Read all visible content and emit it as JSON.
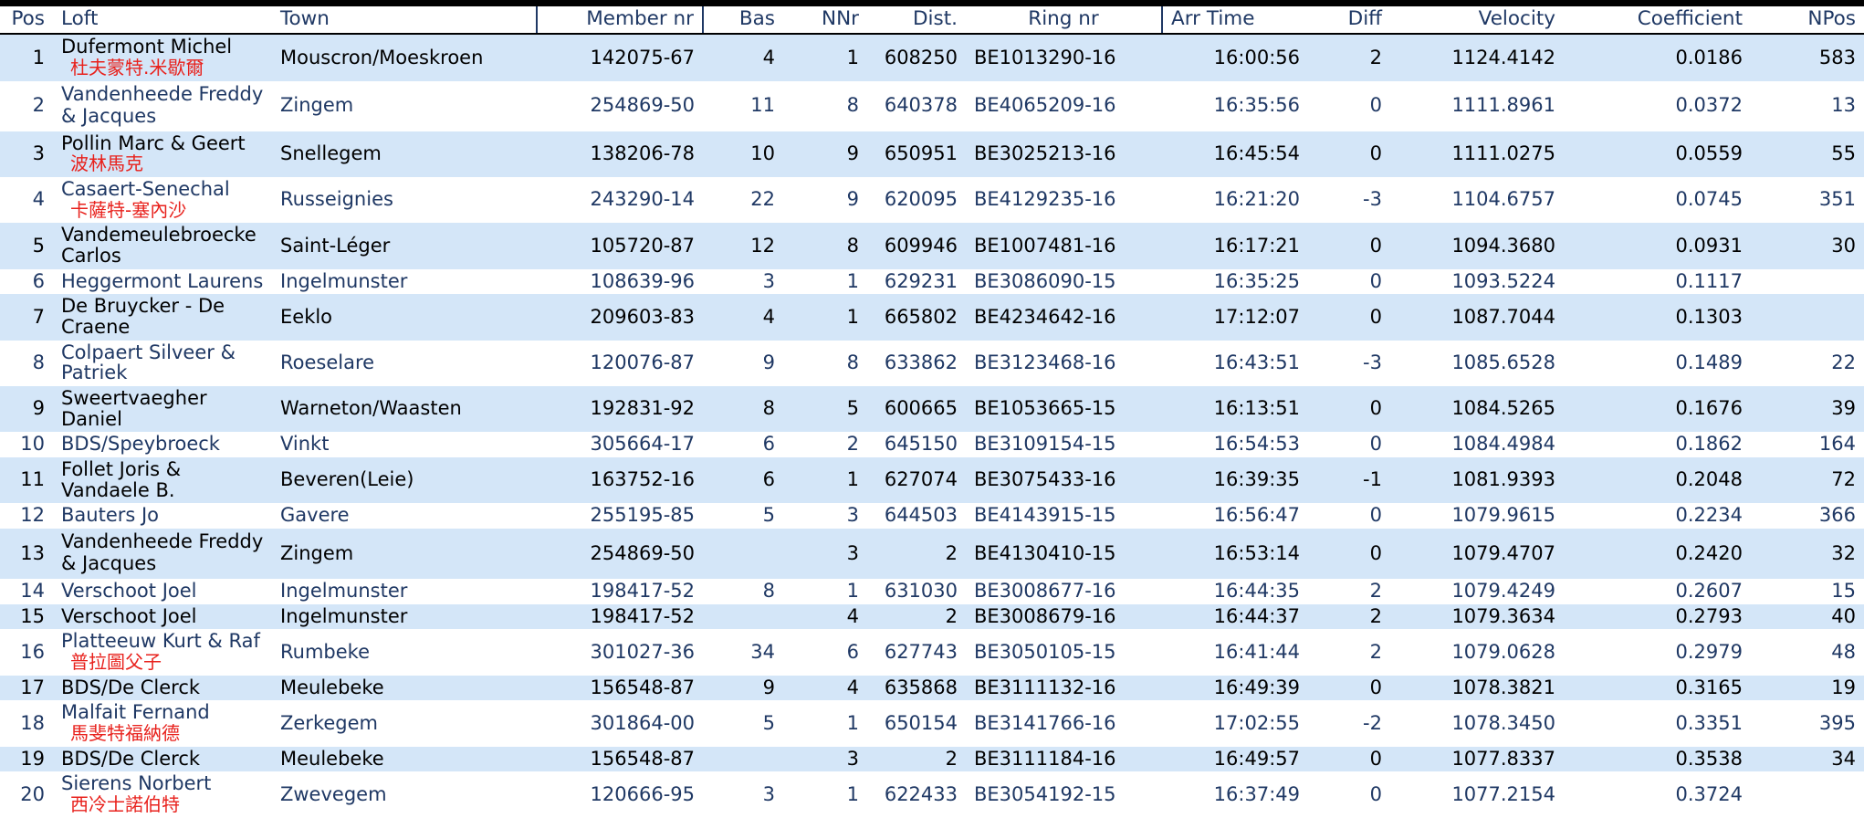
{
  "table": {
    "columns": [
      {
        "key": "pos",
        "label": "Pos",
        "align": "right"
      },
      {
        "key": "loft",
        "label": "Loft",
        "align": "left"
      },
      {
        "key": "town",
        "label": "Town",
        "align": "left"
      },
      {
        "key": "member_nr",
        "label": "Member nr",
        "align": "right"
      },
      {
        "key": "bas",
        "label": "Bas",
        "align": "right"
      },
      {
        "key": "nnr",
        "label": "NNr",
        "align": "right"
      },
      {
        "key": "dist",
        "label": "Dist.",
        "align": "right"
      },
      {
        "key": "ring_nr",
        "label": "Ring nr",
        "align": "left"
      },
      {
        "key": "arr_time",
        "label": "Arr Time",
        "align": "right"
      },
      {
        "key": "diff",
        "label": "Diff",
        "align": "right"
      },
      {
        "key": "velocity",
        "label": "Velocity",
        "align": "right"
      },
      {
        "key": "coefficient",
        "label": "Coefficient",
        "align": "right"
      },
      {
        "key": "npos",
        "label": "NPos",
        "align": "right"
      }
    ],
    "colors": {
      "header_text": "#1f3864",
      "odd_row_bg": "#d4e6f8",
      "even_row_bg": "#ffffff",
      "odd_row_text": "#000000",
      "even_row_text": "#1f3864",
      "chinese_name": "#e8211c",
      "rule": "#000000"
    },
    "rows": [
      {
        "pos": "1",
        "loft": "Dufermont Michel",
        "loft_cn": "杜夫蒙特.米歇爾",
        "town": "Mouscron/Moeskroen",
        "member_nr": "142075-67",
        "bas": "4",
        "nnr": "1",
        "dist": "608250",
        "ring_nr": "BE1013290-16",
        "arr_time": "16:00:56",
        "diff": "2",
        "velocity": "1124.4142",
        "coefficient": "0.0186",
        "npos": "583"
      },
      {
        "pos": "2",
        "loft": "Vandenheede Freddy & Jacques",
        "loft_cn": "",
        "town": "Zingem",
        "member_nr": "254869-50",
        "bas": "11",
        "nnr": "8",
        "dist": "640378",
        "ring_nr": "BE4065209-16",
        "arr_time": "16:35:56",
        "diff": "0",
        "velocity": "1111.8961",
        "coefficient": "0.0372",
        "npos": "13"
      },
      {
        "pos": "3",
        "loft": "Pollin Marc & Geert",
        "loft_cn": "波林馬克",
        "town": "Snellegem",
        "member_nr": "138206-78",
        "bas": "10",
        "nnr": "9",
        "dist": "650951",
        "ring_nr": "BE3025213-16",
        "arr_time": "16:45:54",
        "diff": "0",
        "velocity": "1111.0275",
        "coefficient": "0.0559",
        "npos": "55"
      },
      {
        "pos": "4",
        "loft": "Casaert-Senechal",
        "loft_cn": "卡薩特-塞內沙",
        "town": "Russeignies",
        "member_nr": "243290-14",
        "bas": "22",
        "nnr": "9",
        "dist": "620095",
        "ring_nr": "BE4129235-16",
        "arr_time": "16:21:20",
        "diff": "-3",
        "velocity": "1104.6757",
        "coefficient": "0.0745",
        "npos": "351"
      },
      {
        "pos": "5",
        "loft": "Vandemeulebroecke Carlos",
        "loft_cn": "",
        "town": "Saint-Léger",
        "member_nr": "105720-87",
        "bas": "12",
        "nnr": "8",
        "dist": "609946",
        "ring_nr": "BE1007481-16",
        "arr_time": "16:17:21",
        "diff": "0",
        "velocity": "1094.3680",
        "coefficient": "0.0931",
        "npos": "30"
      },
      {
        "pos": "6",
        "loft": "Heggermont Laurens",
        "loft_cn": "",
        "town": "Ingelmunster",
        "member_nr": "108639-96",
        "bas": "3",
        "nnr": "1",
        "dist": "629231",
        "ring_nr": "BE3086090-15",
        "arr_time": "16:35:25",
        "diff": "0",
        "velocity": "1093.5224",
        "coefficient": "0.1117",
        "npos": ""
      },
      {
        "pos": "7",
        "loft": "De Bruycker - De Craene",
        "loft_cn": "",
        "town": "Eeklo",
        "member_nr": "209603-83",
        "bas": "4",
        "nnr": "1",
        "dist": "665802",
        "ring_nr": "BE4234642-16",
        "arr_time": "17:12:07",
        "diff": "0",
        "velocity": "1087.7044",
        "coefficient": "0.1303",
        "npos": ""
      },
      {
        "pos": "8",
        "loft": "Colpaert Silveer & Patriek",
        "loft_cn": "",
        "town": "Roeselare",
        "member_nr": "120076-87",
        "bas": "9",
        "nnr": "8",
        "dist": "633862",
        "ring_nr": "BE3123468-16",
        "arr_time": "16:43:51",
        "diff": "-3",
        "velocity": "1085.6528",
        "coefficient": "0.1489",
        "npos": "22"
      },
      {
        "pos": "9",
        "loft": "Sweertvaegher Daniel",
        "loft_cn": "",
        "town": "Warneton/Waasten",
        "member_nr": "192831-92",
        "bas": "8",
        "nnr": "5",
        "dist": "600665",
        "ring_nr": "BE1053665-15",
        "arr_time": "16:13:51",
        "diff": "0",
        "velocity": "1084.5265",
        "coefficient": "0.1676",
        "npos": "39"
      },
      {
        "pos": "10",
        "loft": "BDS/Speybroeck",
        "loft_cn": "",
        "town": "Vinkt",
        "member_nr": "305664-17",
        "bas": "6",
        "nnr": "2",
        "dist": "645150",
        "ring_nr": "BE3109154-15",
        "arr_time": "16:54:53",
        "diff": "0",
        "velocity": "1084.4984",
        "coefficient": "0.1862",
        "npos": "164"
      },
      {
        "pos": "11",
        "loft": "Follet Joris & Vandaele B.",
        "loft_cn": "",
        "town": "Beveren(Leie)",
        "member_nr": "163752-16",
        "bas": "6",
        "nnr": "1",
        "dist": "627074",
        "ring_nr": "BE3075433-16",
        "arr_time": "16:39:35",
        "diff": "-1",
        "velocity": "1081.9393",
        "coefficient": "0.2048",
        "npos": "72"
      },
      {
        "pos": "12",
        "loft": "Bauters Jo",
        "loft_cn": "",
        "town": "Gavere",
        "member_nr": "255195-85",
        "bas": "5",
        "nnr": "3",
        "dist": "644503",
        "ring_nr": "BE4143915-15",
        "arr_time": "16:56:47",
        "diff": "0",
        "velocity": "1079.9615",
        "coefficient": "0.2234",
        "npos": "366"
      },
      {
        "pos": "13",
        "loft": "Vandenheede Freddy & Jacques",
        "loft_cn": "",
        "town": "Zingem",
        "member_nr": "254869-50",
        "bas": "",
        "nnr": "3",
        "dist": "2",
        "ring_nr": "BE4130410-15",
        "arr_time": "16:53:14",
        "diff": "0",
        "velocity": "1079.4707",
        "coefficient": "0.2420",
        "npos": "32"
      },
      {
        "pos": "14",
        "loft": "Verschoot Joel",
        "loft_cn": "",
        "town": "Ingelmunster",
        "member_nr": "198417-52",
        "bas": "8",
        "nnr": "1",
        "dist": "631030",
        "ring_nr": "BE3008677-16",
        "arr_time": "16:44:35",
        "diff": "2",
        "velocity": "1079.4249",
        "coefficient": "0.2607",
        "npos": "15"
      },
      {
        "pos": "15",
        "loft": "Verschoot Joel",
        "loft_cn": "",
        "town": "Ingelmunster",
        "member_nr": "198417-52",
        "bas": "",
        "nnr": "4",
        "dist": "2",
        "ring_nr": "BE3008679-16",
        "arr_time": "16:44:37",
        "diff": "2",
        "velocity": "1079.3634",
        "coefficient": "0.2793",
        "npos": "40"
      },
      {
        "pos": "16",
        "loft": "Platteeuw Kurt & Raf",
        "loft_cn": "普拉圖父子",
        "town": "Rumbeke",
        "member_nr": "301027-36",
        "bas": "34",
        "nnr": "6",
        "dist": "627743",
        "ring_nr": "BE3050105-15",
        "arr_time": "16:41:44",
        "diff": "2",
        "velocity": "1079.0628",
        "coefficient": "0.2979",
        "npos": "48"
      },
      {
        "pos": "17",
        "loft": "BDS/De Clerck",
        "loft_cn": "",
        "town": "Meulebeke",
        "member_nr": "156548-87",
        "bas": "9",
        "nnr": "4",
        "dist": "635868",
        "ring_nr": "BE3111132-16",
        "arr_time": "16:49:39",
        "diff": "0",
        "velocity": "1078.3821",
        "coefficient": "0.3165",
        "npos": "19"
      },
      {
        "pos": "18",
        "loft": "Malfait Fernand",
        "loft_cn": "馬斐特福納德",
        "town": "Zerkegem",
        "member_nr": "301864-00",
        "bas": "5",
        "nnr": "1",
        "dist": "650154",
        "ring_nr": "BE3141766-16",
        "arr_time": "17:02:55",
        "diff": "-2",
        "velocity": "1078.3450",
        "coefficient": "0.3351",
        "npos": "395"
      },
      {
        "pos": "19",
        "loft": "BDS/De Clerck",
        "loft_cn": "",
        "town": "Meulebeke",
        "member_nr": "156548-87",
        "bas": "",
        "nnr": "3",
        "dist": "2",
        "ring_nr": "BE3111184-16",
        "arr_time": "16:49:57",
        "diff": "0",
        "velocity": "1077.8337",
        "coefficient": "0.3538",
        "npos": "34"
      },
      {
        "pos": "20",
        "loft": "Sierens Norbert",
        "loft_cn": "西冷士諾伯特",
        "town": "Zwevegem",
        "member_nr": "120666-95",
        "bas": "3",
        "nnr": "1",
        "dist": "622433",
        "ring_nr": "BE3054192-15",
        "arr_time": "16:37:49",
        "diff": "0",
        "velocity": "1077.2154",
        "coefficient": "0.3724",
        "npos": ""
      }
    ]
  }
}
